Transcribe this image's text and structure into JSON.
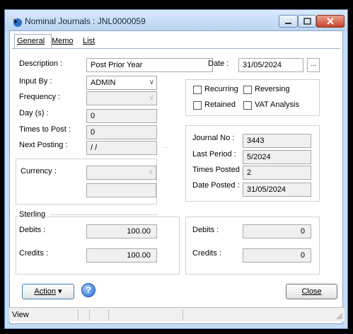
{
  "window": {
    "title": "Nominal Journals : JNL0000059"
  },
  "tabs": [
    "General",
    "Memo",
    "List"
  ],
  "form": {
    "description_label": "Description :",
    "description_value": "Post Prior Year",
    "date_label": "Date :",
    "date_value": "31/05/2024",
    "date_button": "...",
    "input_by_label": "Input By :",
    "input_by_value": "ADMIN",
    "frequency_label": "Frequency :",
    "frequency_value": "",
    "days_label": "Day (s) :",
    "days_value": "0",
    "times_to_post_label": "Times to Post :",
    "times_to_post_value": "0",
    "next_posting_label": "Next Posting :",
    "next_posting_value": " / /",
    "next_posting_button": "...",
    "currency_label": "Currency :",
    "currency_value": "",
    "currency_rate_value": ""
  },
  "options": {
    "recurring": "Recurring",
    "reversing": "Reversing",
    "retained": "Retained",
    "vat_analysis": "VAT Analysis"
  },
  "info": {
    "journal_no_label": "Journal No :",
    "journal_no_value": "3443",
    "last_period_label": "Last Period :",
    "last_period_value": "5/2024",
    "times_posted_label": "Times Posted :",
    "times_posted_value": "2",
    "date_posted_label": "Date Posted :",
    "date_posted_value": "31/05/2024"
  },
  "sterling": {
    "title": "Sterling",
    "debits_label": "Debits :",
    "debits_value": "100.00",
    "credits_label": "Credits :",
    "credits_value": "100.00"
  },
  "currency_totals": {
    "debits_label": "Debits :",
    "debits_value": "0",
    "credits_label": "Credits :",
    "credits_value": "0"
  },
  "buttons": {
    "action": "Action",
    "action_arrow": "▾",
    "help": "?",
    "close": "Close"
  },
  "status": {
    "text": "View"
  }
}
